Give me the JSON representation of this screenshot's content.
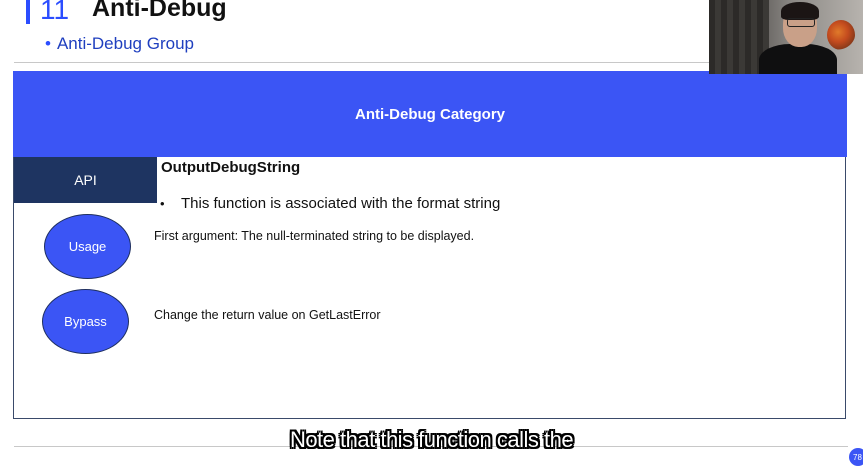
{
  "header": {
    "number": "11",
    "title": "Anti-Debug",
    "subtitle": "Anti-Debug Group"
  },
  "table": {
    "banner": "Anti-Debug Category",
    "api_label": "API",
    "api_name": "OutputDebugString",
    "api_bullet": "This function is associated with the format string",
    "usage_label": "Usage",
    "usage_text": "First argument: The null-terminated string to be displayed.",
    "bypass_label": "Bypass",
    "bypass_text": "Change the return value on GetLastError"
  },
  "caption": "Note that this function calls the",
  "page_number": "78",
  "colors": {
    "accent_blue": "#3b55f5",
    "dark_navy": "#1e3461"
  }
}
